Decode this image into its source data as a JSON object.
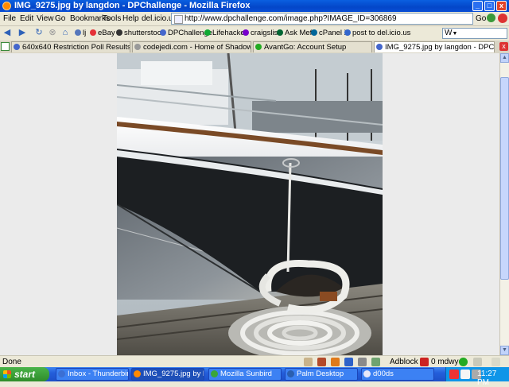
{
  "window": {
    "title": "IMG_9275.jpg by langdon - DPChallenge - Mozilla Firefox",
    "minimize_label": "_",
    "maximize_label": "□",
    "close_label": "x"
  },
  "menu": {
    "items": [
      "File",
      "Edit",
      "View",
      "Go",
      "Bookmarks",
      "Tools",
      "Help",
      "del.icio.us"
    ]
  },
  "address": {
    "url": "http://www.dpchallenge.com/image.php?IMAGE_ID=306869",
    "go_label": "Go"
  },
  "bookmarks": {
    "items": [
      "lj",
      "eBay",
      "shutterstock",
      "DPChallenge",
      "Lifehacker",
      "craigslist",
      "Ask Mefi",
      "cPanel X",
      "post to del.icio.us"
    ],
    "search_engine": "W"
  },
  "tabs": [
    {
      "label": "640x640 Restriction Poll Results - DPChall..."
    },
    {
      "label": "codejedi.com - Home of Shadow Plan for P..."
    },
    {
      "label": "AvantGo: Account Setup"
    },
    {
      "label": "IMG_9275.jpg by langdon - DPChall..."
    }
  ],
  "tab_close_label": "x",
  "status": {
    "left": "Done",
    "adblock": "Adblock",
    "mail": "0 mdwyer"
  },
  "taskbar": {
    "start_label": "start",
    "tasks": [
      {
        "label": "Inbox - Thunderbird",
        "color": "#3b6fd4"
      },
      {
        "label": "IMG_9275.jpg by la...",
        "color": "#ff8a00"
      },
      {
        "label": "Mozilla Sunbird",
        "color": "#3aa63a"
      },
      {
        "label": "Palm Desktop",
        "color": "#2a5fb0"
      },
      {
        "label": "d00ds",
        "color": "#e8e8f8"
      }
    ],
    "clock": "11:27 PM"
  },
  "colors": {
    "titlebar": "#0346c8",
    "taskbar": "#245edb",
    "start": "#2f8c2a"
  }
}
